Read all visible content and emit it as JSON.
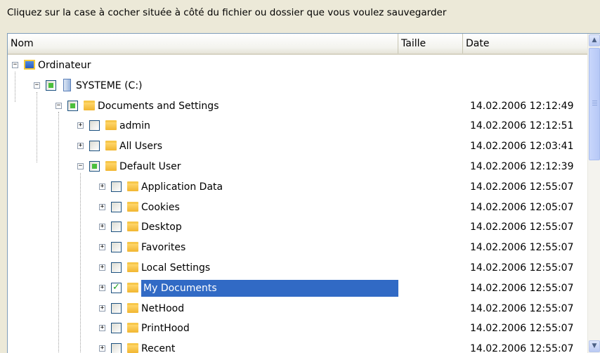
{
  "instruction": "Cliquez sur la case à cocher située à côté du fichier ou dossier que vous voulez sauvegarder",
  "columns": {
    "name": "Nom",
    "size": "Taille",
    "date": "Date"
  },
  "tree": [
    {
      "label": "Ordinateur",
      "date": "",
      "level": 0,
      "expander": "minus",
      "check": "none",
      "icon": "computer-icon"
    },
    {
      "label": "SYSTEME (C:)",
      "date": "",
      "level": 1,
      "expander": "minus",
      "check": "partial",
      "icon": "drive-icon"
    },
    {
      "label": "Documents and Settings",
      "date": "14.02.2006 12:12:49",
      "level": 2,
      "expander": "minus",
      "check": "partial",
      "icon": "folder-icon"
    },
    {
      "label": "admin",
      "date": "14.02.2006 12:12:51",
      "level": 3,
      "expander": "plus",
      "check": "unchecked",
      "icon": "folder-icon"
    },
    {
      "label": "All Users",
      "date": "14.02.2006 12:03:41",
      "level": 3,
      "expander": "plus",
      "check": "unchecked",
      "icon": "folder-icon"
    },
    {
      "label": "Default User",
      "date": "14.02.2006 12:12:39",
      "level": 3,
      "expander": "minus",
      "check": "partial",
      "icon": "folder-icon"
    },
    {
      "label": "Application Data",
      "date": "14.02.2006 12:55:07",
      "level": 4,
      "expander": "plus",
      "check": "unchecked",
      "icon": "folder-icon"
    },
    {
      "label": "Cookies",
      "date": "14.02.2006 12:05:07",
      "level": 4,
      "expander": "plus",
      "check": "unchecked",
      "icon": "folder-icon"
    },
    {
      "label": "Desktop",
      "date": "14.02.2006 12:55:07",
      "level": 4,
      "expander": "plus",
      "check": "unchecked",
      "icon": "folder-icon"
    },
    {
      "label": "Favorites",
      "date": "14.02.2006 12:55:07",
      "level": 4,
      "expander": "plus",
      "check": "unchecked",
      "icon": "folder-icon"
    },
    {
      "label": "Local Settings",
      "date": "14.02.2006 12:55:07",
      "level": 4,
      "expander": "plus",
      "check": "unchecked",
      "icon": "folder-icon"
    },
    {
      "label": "My Documents",
      "date": "14.02.2006 12:55:07",
      "level": 4,
      "expander": "plus",
      "check": "checked",
      "icon": "folder-icon",
      "selected": true
    },
    {
      "label": "NetHood",
      "date": "14.02.2006 12:55:07",
      "level": 4,
      "expander": "plus",
      "check": "unchecked",
      "icon": "folder-icon"
    },
    {
      "label": "PrintHood",
      "date": "14.02.2006 12:55:07",
      "level": 4,
      "expander": "plus",
      "check": "unchecked",
      "icon": "folder-icon"
    },
    {
      "label": "Recent",
      "date": "14.02.2006 12:55:07",
      "level": 4,
      "expander": "plus",
      "check": "unchecked",
      "icon": "folder-icon"
    }
  ],
  "colors": {
    "selection": "#316ac5",
    "border": "#7f9db9",
    "window": "#ece9d8",
    "folder": "#f1b631"
  }
}
